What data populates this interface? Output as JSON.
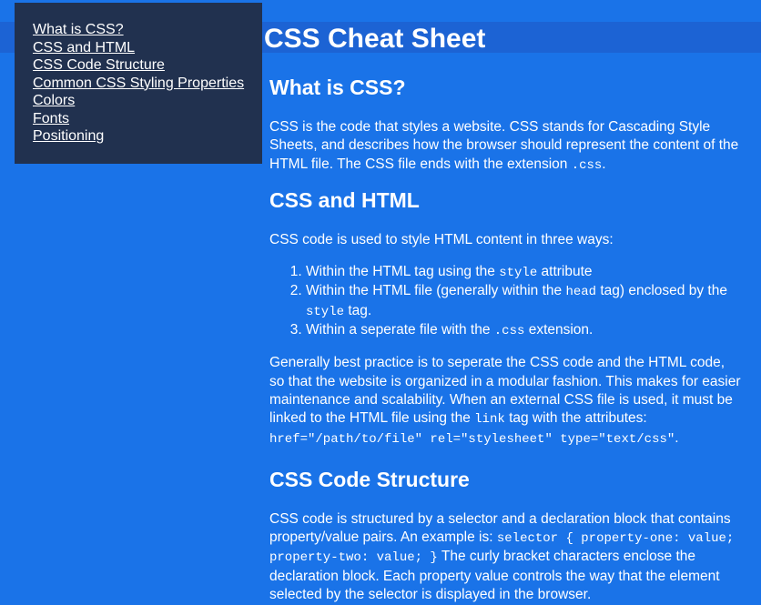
{
  "title": "CSS Cheat Sheet",
  "nav": {
    "items": [
      "What is CSS?",
      "CSS and HTML",
      "CSS Code Structure",
      "Common CSS Styling Properties",
      "Colors",
      "Fonts",
      "Positioning"
    ]
  },
  "sections": {
    "what": {
      "heading": "What is CSS?",
      "p1_text": "CSS is the code that styles a website. CSS stands for Cascading Style Sheets, and describes how the browser should represent the content of the HTML file. The CSS file ends with the extension ",
      "p1_code": ".css",
      "p1_end": "."
    },
    "html": {
      "heading": "CSS and HTML",
      "intro": "CSS code is used to style HTML content in three ways:",
      "list": {
        "item1_pre": "Within the HTML tag using the ",
        "item1_code": "style",
        "item1_post": " attribute",
        "item2_pre": "Within the HTML file (generally within the ",
        "item2_code1": "head",
        "item2_mid": " tag) enclosed by the ",
        "item2_code2": "style",
        "item2_post": " tag.",
        "item3_pre": "Within a seperate file with the ",
        "item3_code": ".css",
        "item3_post": " extension."
      },
      "best_pre": "Generally best practice is to seperate the CSS code and the HTML code, so that the website is organized in a modular fashion. This makes for easier maintenance and scalability. When an external CSS file is used, it must be linked to the HTML file using the ",
      "best_code1": "link",
      "best_mid": " tag with the attributes: ",
      "best_code2": "href=\"/path/to/file\" rel=\"stylesheet\" type=\"text/css\"",
      "best_end": "."
    },
    "structure": {
      "heading": "CSS Code Structure",
      "text_pre": "CSS code is structured by a selector and a declaration block that contains property/value pairs. An example is: ",
      "text_code": "selector { property-one: value; property-two: value; }",
      "text_post": " The curly bracket characters enclose the declaration block. Each property value controls the way that the element selected by the selector is displayed in the browser."
    }
  }
}
